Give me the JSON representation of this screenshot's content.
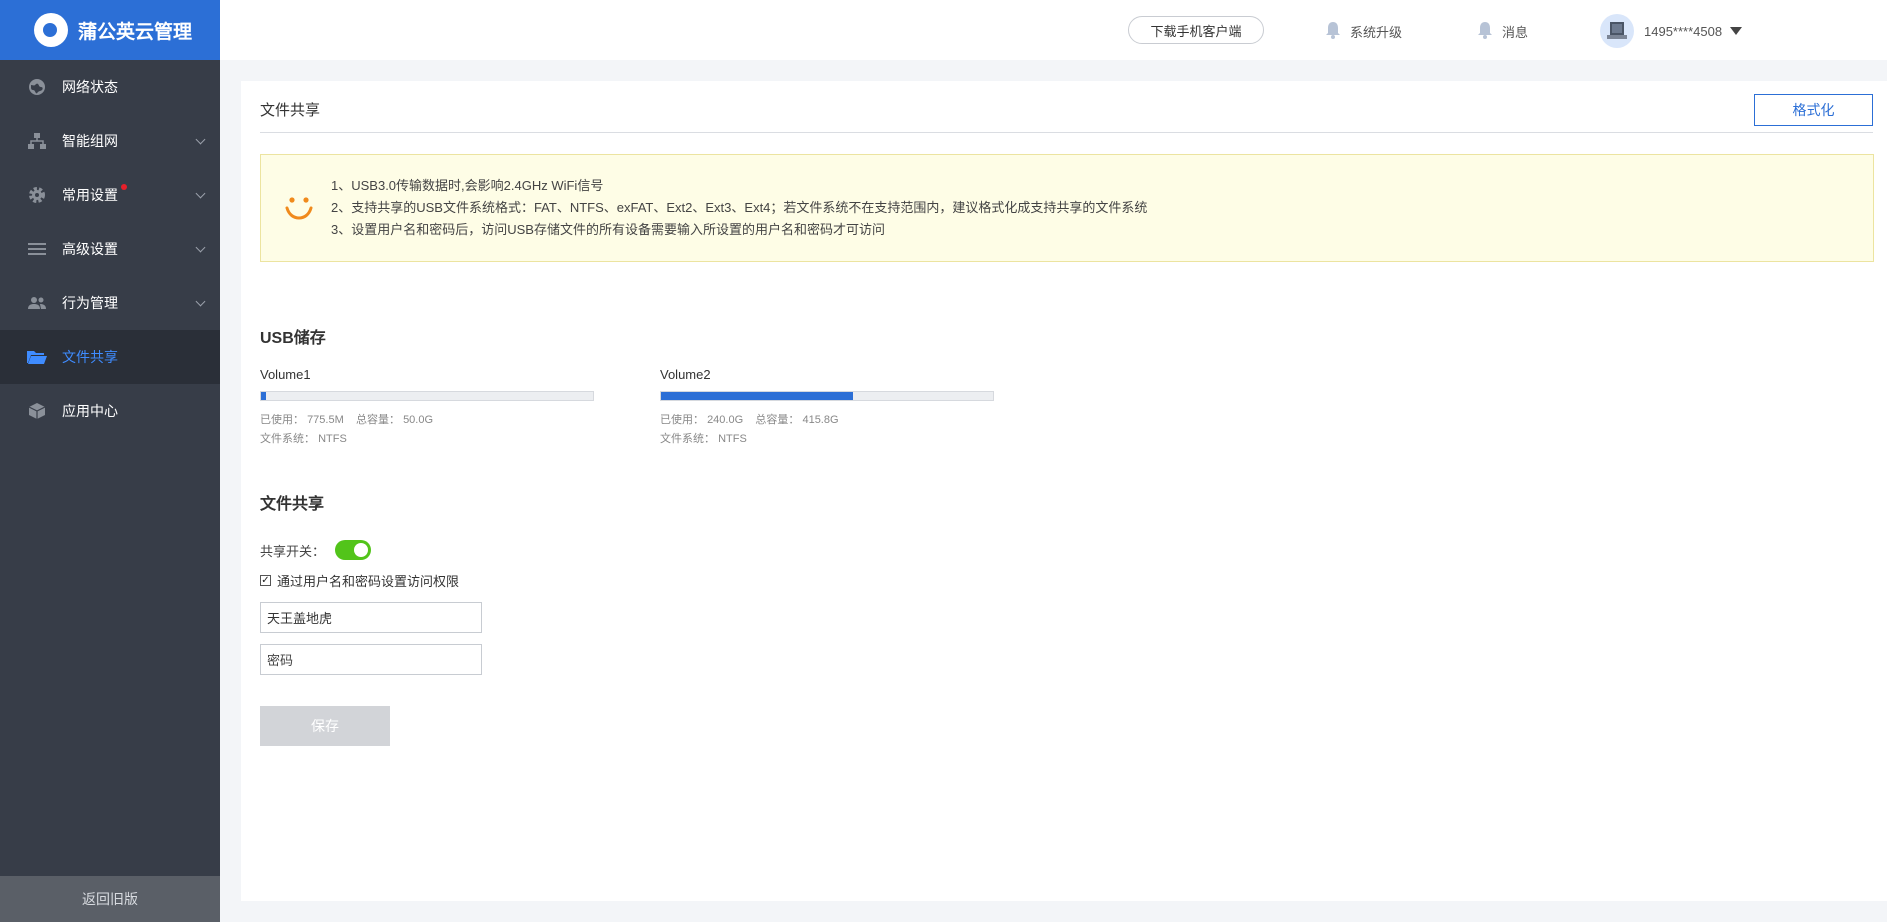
{
  "sidebar": {
    "brand": "蒲公英云管理",
    "items": [
      {
        "label": "网络状态",
        "icon": "globe-icon",
        "has_chevron": false
      },
      {
        "label": "智能组网",
        "icon": "network-icon",
        "has_chevron": true
      },
      {
        "label": "常用设置",
        "icon": "gear-icon",
        "has_chevron": true,
        "badge": true
      },
      {
        "label": "高级设置",
        "icon": "list-icon",
        "has_chevron": true
      },
      {
        "label": "行为管理",
        "icon": "users-icon",
        "has_chevron": true
      },
      {
        "label": "文件共享",
        "icon": "folder-icon",
        "has_chevron": false,
        "active": true
      },
      {
        "label": "应用中心",
        "icon": "box-icon",
        "has_chevron": false
      }
    ],
    "footer": "返回旧版"
  },
  "header": {
    "download": "下载手机客户端",
    "upgrade": "系统升级",
    "messages": "消息",
    "user": "1495****4508"
  },
  "page": {
    "title": "文件共享",
    "format_button": "格式化",
    "notice": [
      "1、USB3.0传输数据时,会影响2.4GHz WiFi信号",
      "2、支持共享的USB文件系统格式：FAT、NTFS、exFAT、Ext2、Ext3、Ext4；若文件系统不在支持范围内，建议格式化成支持共享的文件系统",
      "3、设置用户名和密码后，访问USB存储文件的所有设备需要输入所设置的用户名和密码才可访问"
    ],
    "usb_title": "USB储存",
    "volumes": [
      {
        "name": "Volume1",
        "used_label": "已使用：",
        "used": "775.5M",
        "total_label": "总容量：",
        "total": "50.0G",
        "fs_label": "文件系统：",
        "fs": "NTFS",
        "fill_fraction": 0.0155
      },
      {
        "name": "Volume2",
        "used_label": "已使用：",
        "used": "240.0G",
        "total_label": "总容量：",
        "total": "415.8G",
        "fs_label": "文件系统：",
        "fs": "NTFS",
        "fill_fraction": 0.577
      }
    ],
    "share_title": "文件共享",
    "share_switch_label": "共享开关：",
    "share_enabled": true,
    "auth_checkbox_label": "通过用户名和密码设置访问权限",
    "auth_checked": true,
    "username_value": "天王盖地虎",
    "password_placeholder": "密码",
    "save_button": "保存"
  },
  "colors": {
    "accent": "#2c6fd6",
    "sidebar_bg": "#373d48",
    "toggle_on": "#52c41a"
  }
}
